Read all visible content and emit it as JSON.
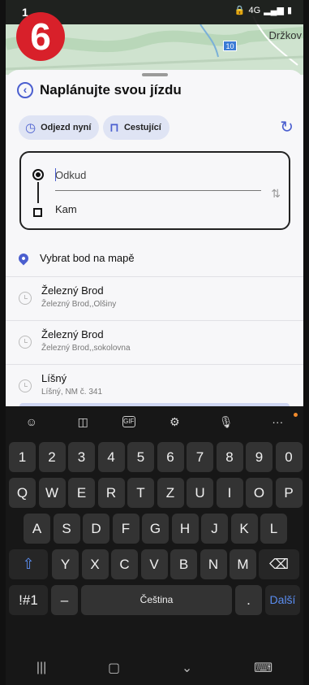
{
  "status": {
    "time": "1",
    "icons": "4G"
  },
  "overlay": {
    "step_number": "6"
  },
  "map": {
    "town_label": "Držkov",
    "route_number": "10"
  },
  "header": {
    "title": "Naplánujte svou jízdu"
  },
  "chips": {
    "depart": "Odjezd nyní",
    "passengers": "Cestující"
  },
  "route": {
    "from_placeholder": "Odkud",
    "to_label": "Kam"
  },
  "pick_on_map": "Vybrat bod na mapě",
  "history": [
    {
      "name": "Železný Brod",
      "detail": "Železný Brod,,Olšiny"
    },
    {
      "name": "Železný Brod",
      "detail": "Železný Brod,,sokolovna"
    },
    {
      "name": "Líšný",
      "detail": "Líšný, NM č. 341"
    }
  ],
  "keyboard": {
    "row_numbers": [
      "1",
      "2",
      "3",
      "4",
      "5",
      "6",
      "7",
      "8",
      "9",
      "0"
    ],
    "row1": [
      "Q",
      "W",
      "E",
      "R",
      "T",
      "Z",
      "U",
      "I",
      "O",
      "P"
    ],
    "row2": [
      "A",
      "S",
      "D",
      "F",
      "G",
      "H",
      "J",
      "K",
      "L"
    ],
    "row3": [
      "Y",
      "X",
      "C",
      "V",
      "B",
      "N",
      "M"
    ],
    "symbols": "!#1",
    "dash": "–",
    "space": "Čeština",
    "period": ".",
    "next": "Další",
    "toolbar": [
      "emoji-icon",
      "sticker-icon",
      "gif-icon",
      "settings-icon",
      "mic-icon",
      "more-icon"
    ],
    "gif_label": "GIF"
  },
  "colors": {
    "accent": "#4b5fcf",
    "badge": "#d8202a",
    "keyboard_bg": "#171717"
  }
}
